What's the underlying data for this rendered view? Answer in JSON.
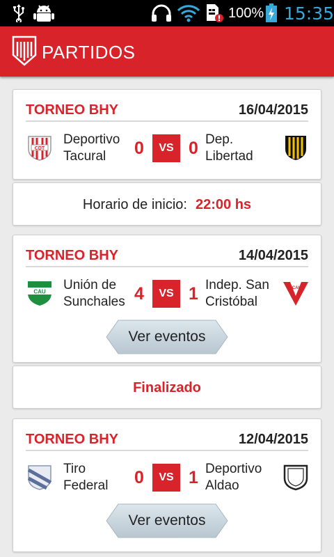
{
  "status_bar": {
    "battery": "100%",
    "time": "15:35",
    "icons": [
      "usb-icon",
      "android-debug-icon",
      "headphones-icon",
      "wifi-icon",
      "sim-alert-icon",
      "battery-charging-icon"
    ]
  },
  "app_bar": {
    "logo": "club-logo",
    "title": "PARTIDOS"
  },
  "matches": [
    {
      "tournament": "TORNEO BHY",
      "date": "16/04/2015",
      "home": {
        "line1": "Deportivo",
        "line2": "Tacural",
        "score": "0",
        "crest": "red-white-shield-crest"
      },
      "vs": "VS",
      "away": {
        "line1": "Dep.",
        "line2": "Libertad",
        "score": "0",
        "crest": "black-yellow-shield-crest"
      },
      "info": {
        "label": "Horario de inicio:",
        "value": "22:00 hs"
      }
    },
    {
      "tournament": "TORNEO BHY",
      "date": "14/04/2015",
      "home": {
        "line1": "Unión de",
        "line2": "Sunchales",
        "score": "4",
        "crest": "green-white-shield-crest"
      },
      "vs": "VS",
      "away": {
        "line1": "Indep. San",
        "line2": "Cristóbal",
        "score": "1",
        "crest": "red-white-shield-crest"
      },
      "button": "Ver eventos",
      "status": "Finalizado"
    },
    {
      "tournament": "TORNEO BHY",
      "date": "12/04/2015",
      "home": {
        "line1": "Tiro",
        "line2": "Federal",
        "score": "0",
        "crest": "blue-white-shield-crest"
      },
      "vs": "VS",
      "away": {
        "line1": "Deportivo",
        "line2": "Aldao",
        "score": "1",
        "crest": "black-white-shield-crest"
      },
      "button": "Ver eventos"
    }
  ]
}
